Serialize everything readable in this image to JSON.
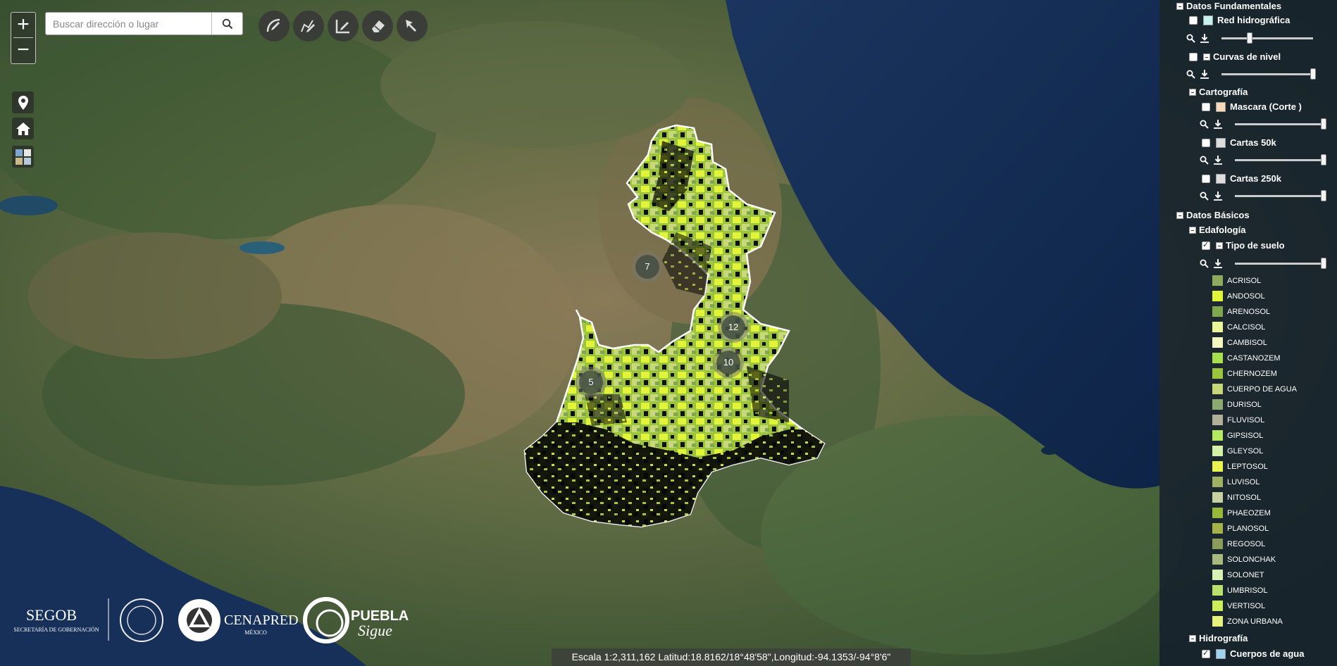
{
  "search": {
    "placeholder": "Buscar dirección o lugar"
  },
  "zoom": {
    "in_label": "+",
    "out_label": "−"
  },
  "tools": [
    {
      "name": "draw-curve-icon"
    },
    {
      "name": "draw-freehand-icon"
    },
    {
      "name": "draw-line-icon"
    },
    {
      "name": "eraser-icon"
    },
    {
      "name": "select-cursor-icon"
    }
  ],
  "left_tools": [
    {
      "name": "location-pin-icon"
    },
    {
      "name": "home-icon"
    },
    {
      "name": "basemap-grid-icon"
    }
  ],
  "clusters": [
    {
      "label": "7"
    },
    {
      "label": "12"
    },
    {
      "label": "10"
    },
    {
      "label": "5"
    }
  ],
  "statusbar": {
    "text": "Escala 1:2,311,162 Latitud:18.8162/18°48'58\",Longitud:-94.1353/-94°8'6\""
  },
  "logos": {
    "segob": "SEGOB",
    "segob_sub": "SECRETARÍA DE GOBERNACIÓN",
    "cenapred": "CENAPRED",
    "cenapred_sub": "MÉXICO",
    "puebla": "PUEBLA",
    "puebla_sub": "Sigue"
  },
  "panel": {
    "sections": {
      "fundamentales": "Datos Fundamentales",
      "red": "Red hidrográfica",
      "curvas": "Curvas de nivel",
      "cartografia": "Cartografía",
      "mascara": "Mascara (Corte )",
      "cartas50": "Cartas 50k",
      "cartas250": "Cartas 250k",
      "basicos": "Datos Básicos",
      "edafologia": "Edafología",
      "tipo": "Tipo de suelo",
      "hidrografia": "Hidrografía",
      "cuerpos": "Cuerpos de agua"
    },
    "colors": {
      "red": "#c6f2ee",
      "mascara": "#f7d9b8",
      "cartas": "#dddddd",
      "cuerpos": "#9fd3f2"
    },
    "legend": [
      {
        "label": "ACRISOL",
        "color": "#8eaa5c"
      },
      {
        "label": "ANDOSOL",
        "color": "#e2f43a"
      },
      {
        "label": "ARENOSOL",
        "color": "#7fa84e"
      },
      {
        "label": "CALCISOL",
        "color": "#eaf59a"
      },
      {
        "label": "CAMBISOL",
        "color": "#f4f8c0"
      },
      {
        "label": "CASTANOZEM",
        "color": "#a6e04a"
      },
      {
        "label": "CHERNOZEM",
        "color": "#9cc43c"
      },
      {
        "label": "CUERPO DE AGUA",
        "color": "#c6d77a"
      },
      {
        "label": "DURISOL",
        "color": "#8da870"
      },
      {
        "label": "FLUVISOL",
        "color": "#b1b097"
      },
      {
        "label": "GIPSISOL",
        "color": "#b4ea62"
      },
      {
        "label": "GLEYSOL",
        "color": "#d5f0a6"
      },
      {
        "label": "LEPTOSOL",
        "color": "#e8f54e"
      },
      {
        "label": "LUVISOL",
        "color": "#9fb264"
      },
      {
        "label": "NITOSOL",
        "color": "#c8d29e"
      },
      {
        "label": "PHAEOZEM",
        "color": "#98b83a"
      },
      {
        "label": "PLANOSOL",
        "color": "#a3b34a"
      },
      {
        "label": "REGOSOL",
        "color": "#8c9c5a"
      },
      {
        "label": "SOLONCHAK",
        "color": "#a9b87c"
      },
      {
        "label": "SOLONET",
        "color": "#d8f0b2"
      },
      {
        "label": "UMBRISOL",
        "color": "#b8e06a"
      },
      {
        "label": "VERTISOL",
        "color": "#ccec5a"
      },
      {
        "label": "ZONA URBANA",
        "color": "#e7f27c"
      }
    ]
  }
}
